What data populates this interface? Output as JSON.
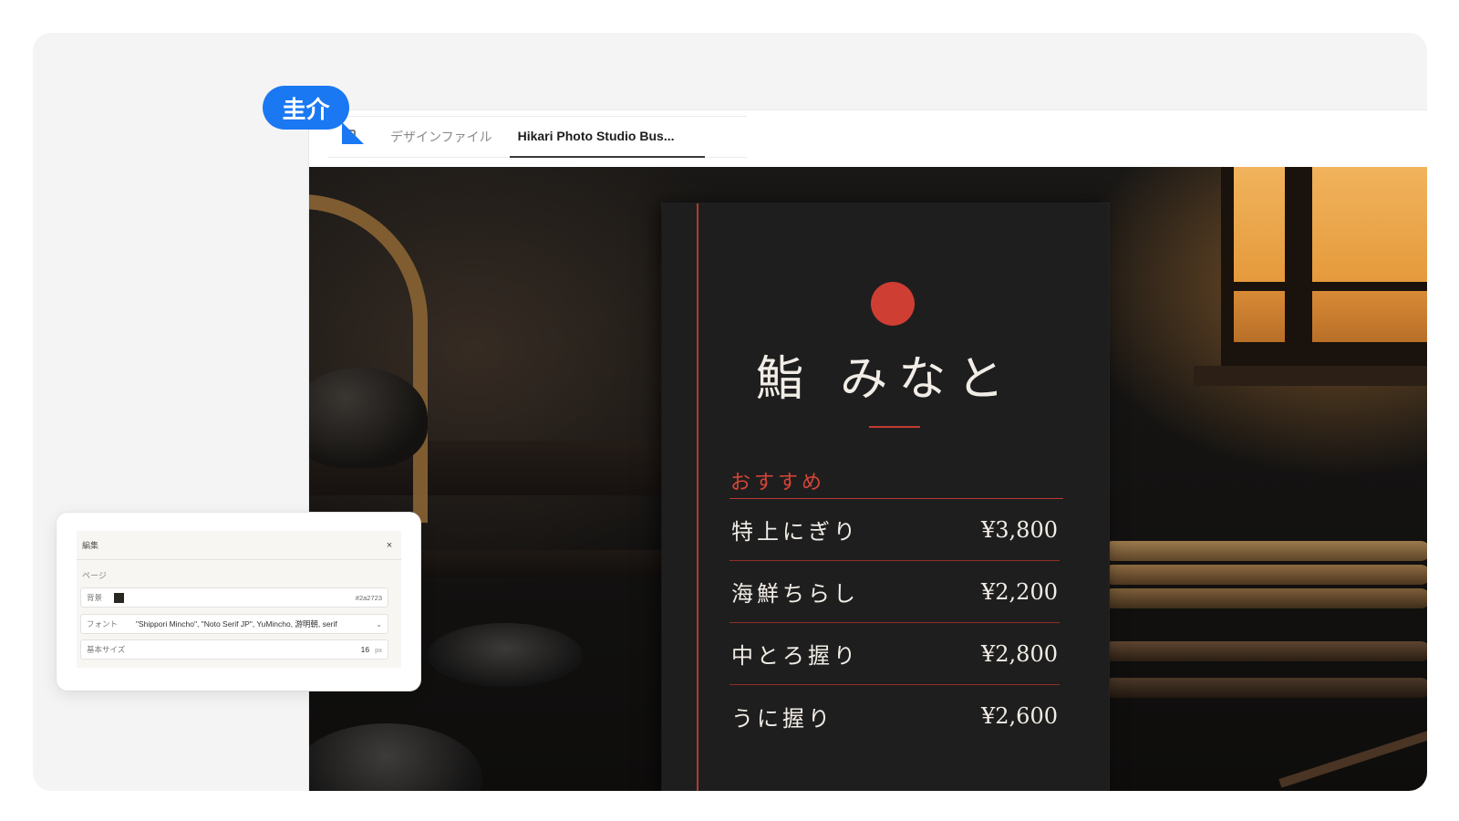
{
  "user": {
    "name": "圭介",
    "color": "#1a78f2"
  },
  "tabs": {
    "design_files": "デザインファイル",
    "active": "Hikari Photo Studio Bus..."
  },
  "menu": {
    "title": "鮨 みなと",
    "section": "おすすめ",
    "items": [
      {
        "name": "特上にぎり",
        "price": "¥3,800"
      },
      {
        "name": "海鮮ちらし",
        "price": "¥2,200"
      },
      {
        "name": "中とろ握り",
        "price": "¥2,800"
      },
      {
        "name": "うに握り",
        "price": "¥2,600"
      }
    ],
    "accent": "#cf3e33",
    "board_color": "#1f1e1f"
  },
  "edit_panel": {
    "title": "編集",
    "close": "×",
    "section": "ページ",
    "background": {
      "label": "背景",
      "value": "#2a2723"
    },
    "font": {
      "label": "フォント",
      "value": "\"Shippori Mincho\", \"Noto Serif JP\", YuMincho, 游明朝, serif"
    },
    "base_size": {
      "label": "基本サイズ",
      "value": "16",
      "unit": "px"
    }
  }
}
